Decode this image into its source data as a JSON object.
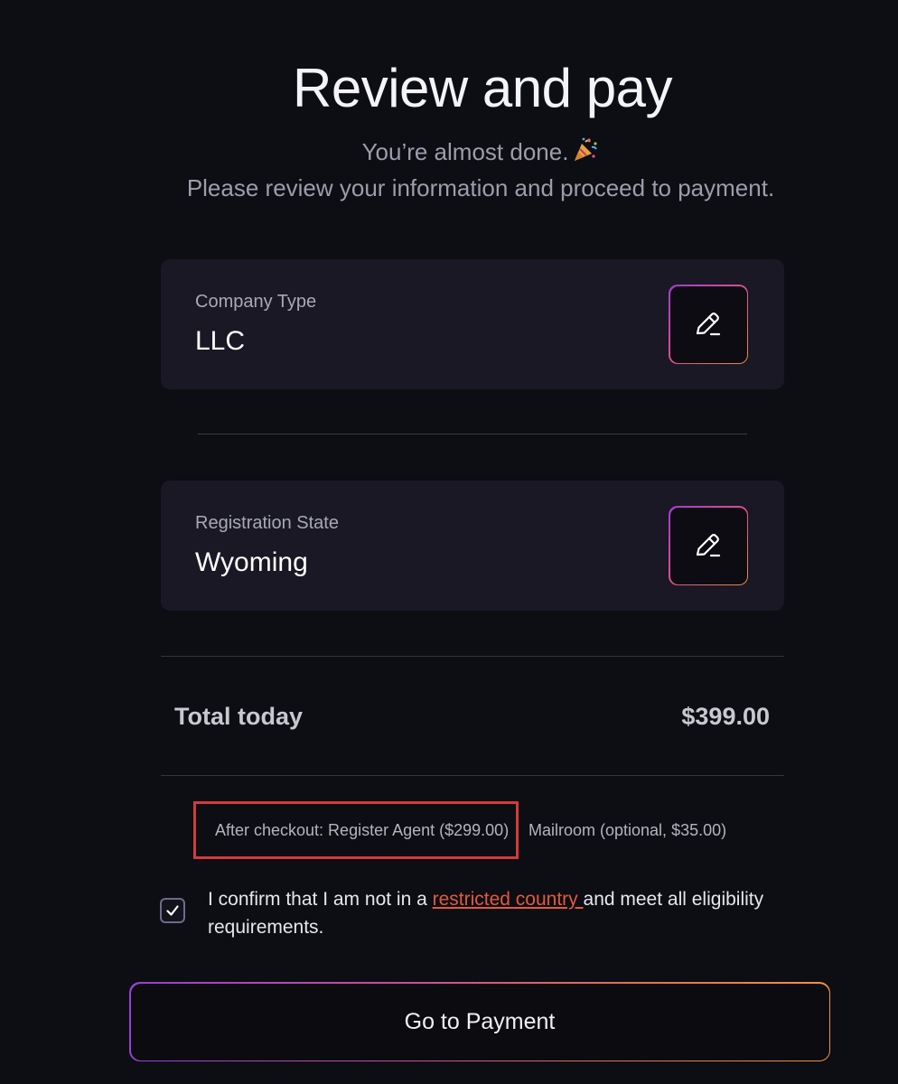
{
  "header": {
    "title": "Review and pay",
    "subtitle_line1": "You’re almost done.",
    "subtitle_icon": "party-popper-icon",
    "subtitle_line2": "Please review your information and proceed to payment."
  },
  "company_type": {
    "label": "Company Type",
    "value": "LLC",
    "edit_icon": "pencil-icon"
  },
  "registration_state": {
    "label": "Registration State",
    "value": "Wyoming",
    "edit_icon": "pencil-icon"
  },
  "total": {
    "label": "Total today",
    "value": "$399.00"
  },
  "after_checkout": {
    "note1": "After checkout: Register Agent ($299.00)",
    "note2": "Mailroom (optional, $35.00)",
    "highlight_color": "#d53a3a"
  },
  "confirmation": {
    "checked": true,
    "text_before": "I confirm that I am not in a ",
    "link_text": "restricted country ",
    "text_after": "and meet all eligibility requirements.",
    "link_color": "#e05a3c"
  },
  "actions": {
    "pay_label": "Go to Payment"
  },
  "colors": {
    "background": "#0d0d14",
    "card": "#191824",
    "gradient_start": "#9b3fd6",
    "gradient_end": "#f2933a"
  }
}
